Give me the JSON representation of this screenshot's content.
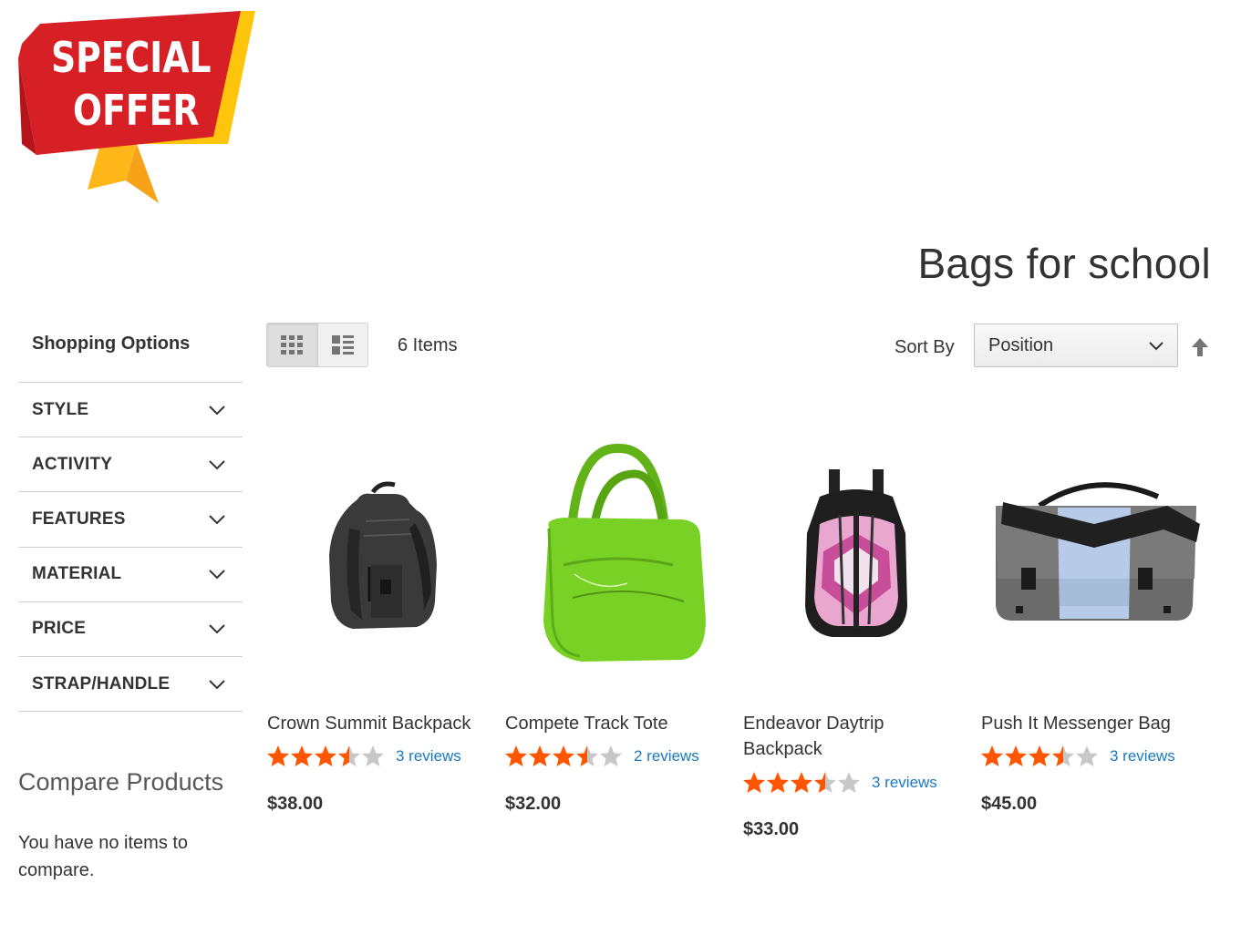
{
  "banner": {
    "line1": "SPECIAL",
    "line2": "OFFER",
    "colors": {
      "red": "#d71f26",
      "yellow": "#ffc40c",
      "orange": "#f6a31a"
    }
  },
  "page_title": "Bags for school",
  "sidebar": {
    "heading": "Shopping Options",
    "filters": [
      {
        "label": "STYLE"
      },
      {
        "label": "ACTIVITY"
      },
      {
        "label": "FEATURES"
      },
      {
        "label": "MATERIAL"
      },
      {
        "label": "PRICE"
      },
      {
        "label": "STRAP/HANDLE"
      }
    ],
    "compare_title": "Compare Products",
    "compare_empty": "You have no items to compare."
  },
  "toolbar": {
    "view_modes": [
      {
        "icon": "grid-icon",
        "active": true
      },
      {
        "icon": "list-icon",
        "active": false
      }
    ],
    "items_count": "6 Items",
    "sort_label": "Sort By",
    "sort_value": "Position",
    "sort_direction_icon": "arrow-up-icon"
  },
  "colors": {
    "star": "#ff5501",
    "star_empty": "#c7c7c7",
    "link": "#1979c3"
  },
  "products": [
    {
      "name": "Crown Summit Backpack",
      "rating": 3.5,
      "reviews": "3 reviews",
      "price": "$38.00",
      "image_icon": "black-backpack"
    },
    {
      "name": "Compete Track Tote",
      "rating": 3.5,
      "reviews": "2 reviews",
      "price": "$32.00",
      "image_icon": "green-tote"
    },
    {
      "name": "Endeavor Daytrip Backpack",
      "rating": 3.5,
      "reviews": "3 reviews",
      "price": "$33.00",
      "image_icon": "pink-backpack"
    },
    {
      "name": "Push It Messenger Bag",
      "rating": 3.5,
      "reviews": "3 reviews",
      "price": "$45.00",
      "image_icon": "messenger-bag"
    }
  ]
}
